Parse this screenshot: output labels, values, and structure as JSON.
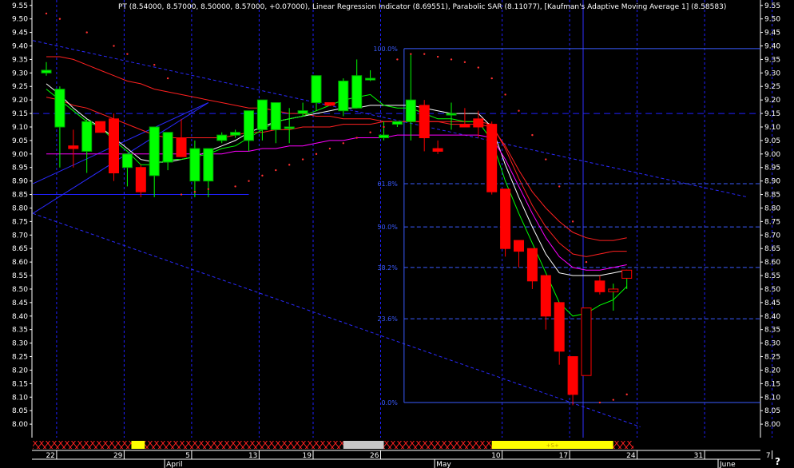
{
  "title": "PT (8.54000, 8.57000, 8.50000, 8.57000, +0.07000), Linear Regression Indicator (8.69551), Parabolic SAR (8.11077), [Kaufman's Adaptive Moving Average 1] (8.58583)",
  "help_label": "?",
  "colors": {
    "up": "#00ff00",
    "down": "#ff0000",
    "grid": "#2020ff",
    "axis_text": "#ffffff",
    "fib": "#3a5bff",
    "lr": "#ff2020",
    "white_ma": "#ffffff",
    "green_ma": "#00ff00",
    "magenta_ma": "#ff00ff",
    "sar": "#ff3030",
    "channel": "#2a2aff",
    "cursor": "#3030ff"
  },
  "chart_data": {
    "type": "candlestick",
    "ylim": [
      7.95,
      9.57
    ],
    "y_ticks": [
      "9.55",
      "9.50",
      "9.45",
      "9.40",
      "9.35",
      "9.30",
      "9.25",
      "9.20",
      "9.15",
      "9.10",
      "9.05",
      "9.00",
      "8.95",
      "8.90",
      "8.85",
      "8.80",
      "8.75",
      "8.70",
      "8.65",
      "8.60",
      "8.55",
      "8.50",
      "8.45",
      "8.40",
      "8.35",
      "8.30",
      "8.25",
      "8.20",
      "8.15",
      "8.10",
      "8.05",
      "8.00"
    ],
    "x_tick_labels": [
      {
        "label": "22",
        "i": 1
      },
      {
        "label": "29",
        "i": 6
      },
      {
        "label": "5",
        "i": 11
      },
      {
        "label": "13",
        "i": 16
      },
      {
        "label": "19",
        "i": 20
      },
      {
        "label": "26",
        "i": 25
      },
      {
        "label": "10",
        "i": 34
      },
      {
        "label": "17",
        "i": 39
      },
      {
        "label": "24",
        "i": 44
      },
      {
        "label": "31",
        "i": 49
      },
      {
        "label": "7",
        "i": 54
      }
    ],
    "month_labels": [
      {
        "label": "April",
        "i": 9
      },
      {
        "label": "May",
        "i": 29
      },
      {
        "label": "June",
        "i": 50
      }
    ],
    "candles": [
      {
        "o": 9.3,
        "h": 9.34,
        "l": 9.29,
        "c": 9.31
      },
      {
        "o": 9.1,
        "h": 9.25,
        "l": 8.95,
        "c": 9.24
      },
      {
        "o": 9.03,
        "h": 9.09,
        "l": 8.95,
        "c": 9.02
      },
      {
        "o": 9.01,
        "h": 9.13,
        "l": 8.93,
        "c": 9.12
      },
      {
        "o": 9.12,
        "h": 9.12,
        "l": 9.08,
        "c": 9.08
      },
      {
        "o": 9.13,
        "h": 9.15,
        "l": 8.9,
        "c": 8.93
      },
      {
        "o": 8.95,
        "h": 8.99,
        "l": 8.88,
        "c": 9.0
      },
      {
        "o": 8.95,
        "h": 8.96,
        "l": 8.84,
        "c": 8.86
      },
      {
        "o": 8.92,
        "h": 9.08,
        "l": 8.84,
        "c": 9.1
      },
      {
        "o": 8.97,
        "h": 9.08,
        "l": 8.94,
        "c": 9.08
      },
      {
        "o": 9.06,
        "h": 9.13,
        "l": 9.01,
        "c": 8.99
      },
      {
        "o": 8.9,
        "h": 9.05,
        "l": 8.84,
        "c": 9.02
      },
      {
        "o": 8.9,
        "h": 9.01,
        "l": 8.84,
        "c": 9.02
      },
      {
        "o": 9.05,
        "h": 9.08,
        "l": 9.04,
        "c": 9.07
      },
      {
        "o": 9.07,
        "h": 9.09,
        "l": 9.06,
        "c": 9.08
      },
      {
        "o": 9.05,
        "h": 9.11,
        "l": 9.01,
        "c": 9.16
      },
      {
        "o": 9.09,
        "h": 9.2,
        "l": 9.05,
        "c": 9.2
      },
      {
        "o": 9.09,
        "h": 9.19,
        "l": 9.04,
        "c": 9.19
      },
      {
        "o": 9.1,
        "h": 9.17,
        "l": 9.04,
        "c": 9.1
      },
      {
        "o": 9.15,
        "h": 9.19,
        "l": 9.14,
        "c": 9.16
      },
      {
        "o": 9.19,
        "h": 9.2,
        "l": 9.16,
        "c": 9.29
      },
      {
        "o": 9.19,
        "h": 9.19,
        "l": 9.18,
        "c": 9.18
      },
      {
        "o": 9.16,
        "h": 9.28,
        "l": 9.14,
        "c": 9.27
      },
      {
        "o": 9.17,
        "h": 9.35,
        "l": 9.17,
        "c": 9.29
      },
      {
        "o": 9.28,
        "h": 9.31,
        "l": 9.27,
        "c": 9.28
      },
      {
        "o": 9.06,
        "h": 9.12,
        "l": 9.05,
        "c": 9.07
      },
      {
        "o": 9.11,
        "h": 9.12,
        "l": 9.1,
        "c": 9.12
      },
      {
        "o": 9.12,
        "h": 9.37,
        "l": 9.05,
        "c": 9.2
      },
      {
        "o": 9.18,
        "h": 9.2,
        "l": 9.01,
        "c": 9.06
      },
      {
        "o": 9.02,
        "h": 9.05,
        "l": 9.0,
        "c": 9.01
      },
      {
        "o": 9.15,
        "h": 9.19,
        "l": 9.09,
        "c": 9.15
      },
      {
        "o": 9.11,
        "h": 9.17,
        "l": 9.1,
        "c": 9.1
      },
      {
        "o": 9.13,
        "h": 9.16,
        "l": 9.06,
        "c": 9.1
      },
      {
        "o": 9.11,
        "h": 9.12,
        "l": 8.85,
        "c": 8.86
      },
      {
        "o": 8.87,
        "h": 8.87,
        "l": 8.62,
        "c": 8.65
      },
      {
        "o": 8.68,
        "h": 8.68,
        "l": 8.58,
        "c": 8.64
      },
      {
        "o": 8.65,
        "h": 8.65,
        "l": 8.5,
        "c": 8.53
      },
      {
        "o": 8.55,
        "h": 8.55,
        "l": 8.35,
        "c": 8.4
      },
      {
        "o": 8.45,
        "h": 8.45,
        "l": 8.22,
        "c": 8.27
      },
      {
        "o": 8.25,
        "h": 8.25,
        "l": 8.07,
        "c": 8.11
      },
      {
        "o": 8.18,
        "h": 8.42,
        "l": 8.18,
        "c": 8.43
      },
      {
        "o": 8.53,
        "h": 8.55,
        "l": 8.48,
        "c": 8.49
      },
      {
        "o": 8.49,
        "h": 8.52,
        "l": 8.42,
        "c": 8.5
      },
      {
        "o": 8.54,
        "h": 8.57,
        "l": 8.5,
        "c": 8.57
      }
    ],
    "series": [
      {
        "key": "lr",
        "values": [
          9.36,
          9.36,
          9.35,
          9.33,
          9.31,
          9.29,
          9.27,
          9.26,
          9.24,
          9.23,
          9.22,
          9.21,
          9.2,
          9.19,
          9.18,
          9.17,
          9.17,
          9.16,
          9.15,
          9.15,
          9.14,
          9.14,
          9.13,
          9.13,
          9.13,
          9.12,
          9.12,
          9.12,
          9.12,
          9.12,
          9.11,
          9.11,
          9.11,
          9.1,
          9.03,
          8.94,
          8.86,
          8.8,
          8.75,
          8.71,
          8.69,
          8.68,
          8.68,
          8.69
        ]
      },
      {
        "key": "lr2",
        "values": [
          9.21,
          9.2,
          9.18,
          9.17,
          9.15,
          9.13,
          9.11,
          9.09,
          9.07,
          9.06,
          9.06,
          9.06,
          9.06,
          9.06,
          9.07,
          9.08,
          9.08,
          9.09,
          9.09,
          9.1,
          9.1,
          9.1,
          9.11,
          9.11,
          9.11,
          9.12,
          9.12,
          9.12,
          9.12,
          9.12,
          9.12,
          9.12,
          9.12,
          9.11,
          9.02,
          8.91,
          8.81,
          8.73,
          8.67,
          8.63,
          8.62,
          8.63,
          8.64,
          8.64
        ]
      },
      {
        "key": "white",
        "values": [
          9.26,
          9.22,
          9.17,
          9.13,
          9.1,
          9.06,
          9.02,
          8.98,
          8.97,
          8.97,
          8.98,
          8.99,
          9.01,
          9.03,
          9.05,
          9.08,
          9.1,
          9.12,
          9.13,
          9.14,
          9.15,
          9.16,
          9.17,
          9.17,
          9.18,
          9.18,
          9.18,
          9.18,
          9.17,
          9.16,
          9.15,
          9.15,
          9.15,
          9.1,
          8.96,
          8.84,
          8.73,
          8.63,
          8.56,
          8.55,
          8.55,
          8.55,
          8.56,
          8.57
        ]
      },
      {
        "key": "green",
        "values": [
          9.24,
          9.2,
          9.16,
          9.12,
          9.1,
          9.05,
          9.01,
          8.96,
          8.96,
          8.98,
          8.98,
          8.99,
          9.0,
          9.02,
          9.03,
          9.06,
          9.09,
          9.12,
          9.13,
          9.14,
          9.16,
          9.18,
          9.2,
          9.21,
          9.22,
          9.18,
          9.17,
          9.17,
          9.15,
          9.13,
          9.13,
          9.12,
          9.12,
          9.05,
          8.9,
          8.78,
          8.67,
          8.56,
          8.45,
          8.4,
          8.41,
          8.44,
          8.46,
          8.51
        ]
      },
      {
        "key": "magenta",
        "values": [
          9.0,
          9.0,
          9.0,
          9.0,
          9.0,
          9.0,
          9.0,
          9.0,
          9.0,
          9.0,
          9.0,
          9.0,
          9.0,
          9.0,
          9.01,
          9.01,
          9.02,
          9.02,
          9.03,
          9.03,
          9.04,
          9.05,
          9.05,
          9.06,
          9.06,
          9.06,
          9.07,
          9.07,
          9.07,
          9.07,
          9.07,
          9.07,
          9.07,
          9.06,
          8.98,
          8.88,
          8.78,
          8.69,
          8.62,
          8.58,
          8.57,
          8.57,
          8.58,
          8.59
        ]
      }
    ],
    "sar": [
      {
        "i": 0,
        "v": 9.52
      },
      {
        "i": 1,
        "v": 9.5
      },
      {
        "i": 3,
        "v": 9.45
      },
      {
        "i": 5,
        "v": 9.4
      },
      {
        "i": 6,
        "v": 9.37
      },
      {
        "i": 8,
        "v": 9.33
      },
      {
        "i": 9,
        "v": 9.28
      },
      {
        "i": 10,
        "v": 8.85
      },
      {
        "i": 11,
        "v": 8.86
      },
      {
        "i": 12,
        "v": 8.87
      },
      {
        "i": 14,
        "v": 8.88
      },
      {
        "i": 15,
        "v": 8.9
      },
      {
        "i": 16,
        "v": 8.92
      },
      {
        "i": 17,
        "v": 8.94
      },
      {
        "i": 18,
        "v": 8.96
      },
      {
        "i": 19,
        "v": 8.98
      },
      {
        "i": 20,
        "v": 9.0
      },
      {
        "i": 21,
        "v": 9.02
      },
      {
        "i": 22,
        "v": 9.04
      },
      {
        "i": 23,
        "v": 9.06
      },
      {
        "i": 24,
        "v": 9.08
      },
      {
        "i": 25,
        "v": 9.1
      },
      {
        "i": 26,
        "v": 9.35
      },
      {
        "i": 27,
        "v": 9.37
      },
      {
        "i": 28,
        "v": 9.37
      },
      {
        "i": 29,
        "v": 9.36
      },
      {
        "i": 30,
        "v": 9.35
      },
      {
        "i": 31,
        "v": 9.34
      },
      {
        "i": 32,
        "v": 9.32
      },
      {
        "i": 33,
        "v": 9.28
      },
      {
        "i": 34,
        "v": 9.22
      },
      {
        "i": 35,
        "v": 9.16
      },
      {
        "i": 36,
        "v": 9.07
      },
      {
        "i": 37,
        "v": 8.98
      },
      {
        "i": 38,
        "v": 8.88
      },
      {
        "i": 39,
        "v": 8.75
      },
      {
        "i": 40,
        "v": 8.6
      },
      {
        "i": 41,
        "v": 8.08
      },
      {
        "i": 42,
        "v": 8.09
      },
      {
        "i": 43,
        "v": 8.11
      }
    ],
    "fib_levels": [
      {
        "label": "100.0%",
        "v": 9.39
      },
      {
        "label": "61.8%",
        "v": 8.89
      },
      {
        "label": "50.0%",
        "v": 8.73
      },
      {
        "label": "38.2%",
        "v": 8.58
      },
      {
        "label": "23.6%",
        "v": 8.39
      },
      {
        "label": "0.0%",
        "v": 8.08
      }
    ],
    "hlines": [
      {
        "v": 9.15,
        "dashed": true,
        "i0": -1,
        "i1": 56
      },
      {
        "v": 8.85,
        "dashed": false,
        "i0": -1,
        "i1": 15
      }
    ],
    "channel_lines": [
      {
        "i0": -1,
        "v0": 9.42,
        "i1": 52,
        "v1": 8.84
      },
      {
        "i0": -1,
        "v0": 8.78,
        "i1": 44,
        "v1": 7.99
      }
    ],
    "trend_lines": [
      {
        "i0": -1,
        "v0": 8.78,
        "i1": 12,
        "v1": 9.19
      },
      {
        "i0": -1,
        "v0": 8.89,
        "i1": 12,
        "v1": 9.19
      }
    ],
    "cursor_index": 40,
    "bottom_strip": {
      "segments": [
        {
          "i0": -1,
          "i1": 6.3,
          "kind": "x"
        },
        {
          "i0": 6.3,
          "i1": 7.3,
          "kind": "yellow"
        },
        {
          "i0": 7.3,
          "i1": 22.0,
          "kind": "x"
        },
        {
          "i0": 22.0,
          "i1": 25.0,
          "kind": "gray"
        },
        {
          "i0": 25.0,
          "i1": 33.0,
          "kind": "x"
        },
        {
          "i0": 33.0,
          "i1": 42.0,
          "kind": "yellow",
          "label": "+S+"
        },
        {
          "i0": 42.0,
          "i1": 43.5,
          "kind": "x"
        }
      ]
    }
  }
}
